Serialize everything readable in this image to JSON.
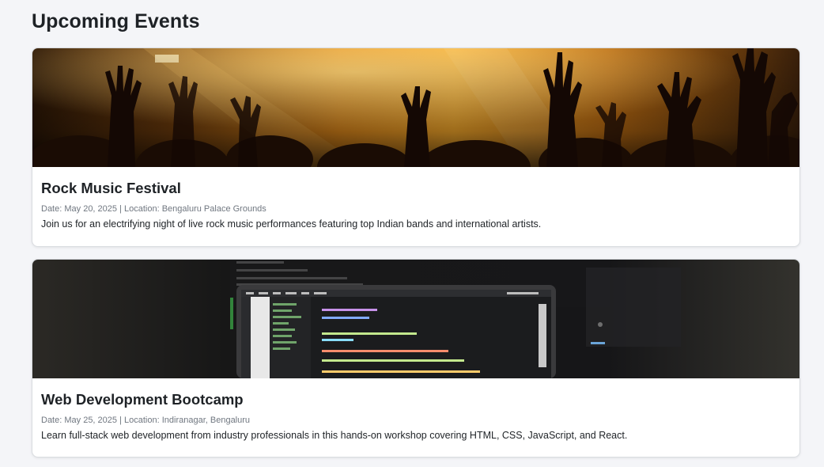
{
  "page": {
    "title": "Upcoming Events"
  },
  "events": [
    {
      "title": "Rock Music Festival",
      "date_label": "Date:",
      "date": "May 20, 2025",
      "location_label": "Location:",
      "location": "Bengaluru Palace Grounds",
      "description": "Join us for an electrifying night of live rock music performances featuring top Indian bands and international artists.",
      "image": "concert-crowd-image"
    },
    {
      "title": "Web Development Bootcamp",
      "date_label": "Date:",
      "date": "May 25, 2025",
      "location_label": "Location:",
      "location": "Indiranagar, Bengaluru",
      "description": "Learn full-stack web development from industry professionals in this hands-on workshop covering HTML, CSS, JavaScript, and React.",
      "image": "laptop-code-image"
    }
  ],
  "colors": {
    "background": "#f4f5f8",
    "card": "#ffffff",
    "meta_text": "#707780",
    "concert_glow": "#f0a020"
  }
}
